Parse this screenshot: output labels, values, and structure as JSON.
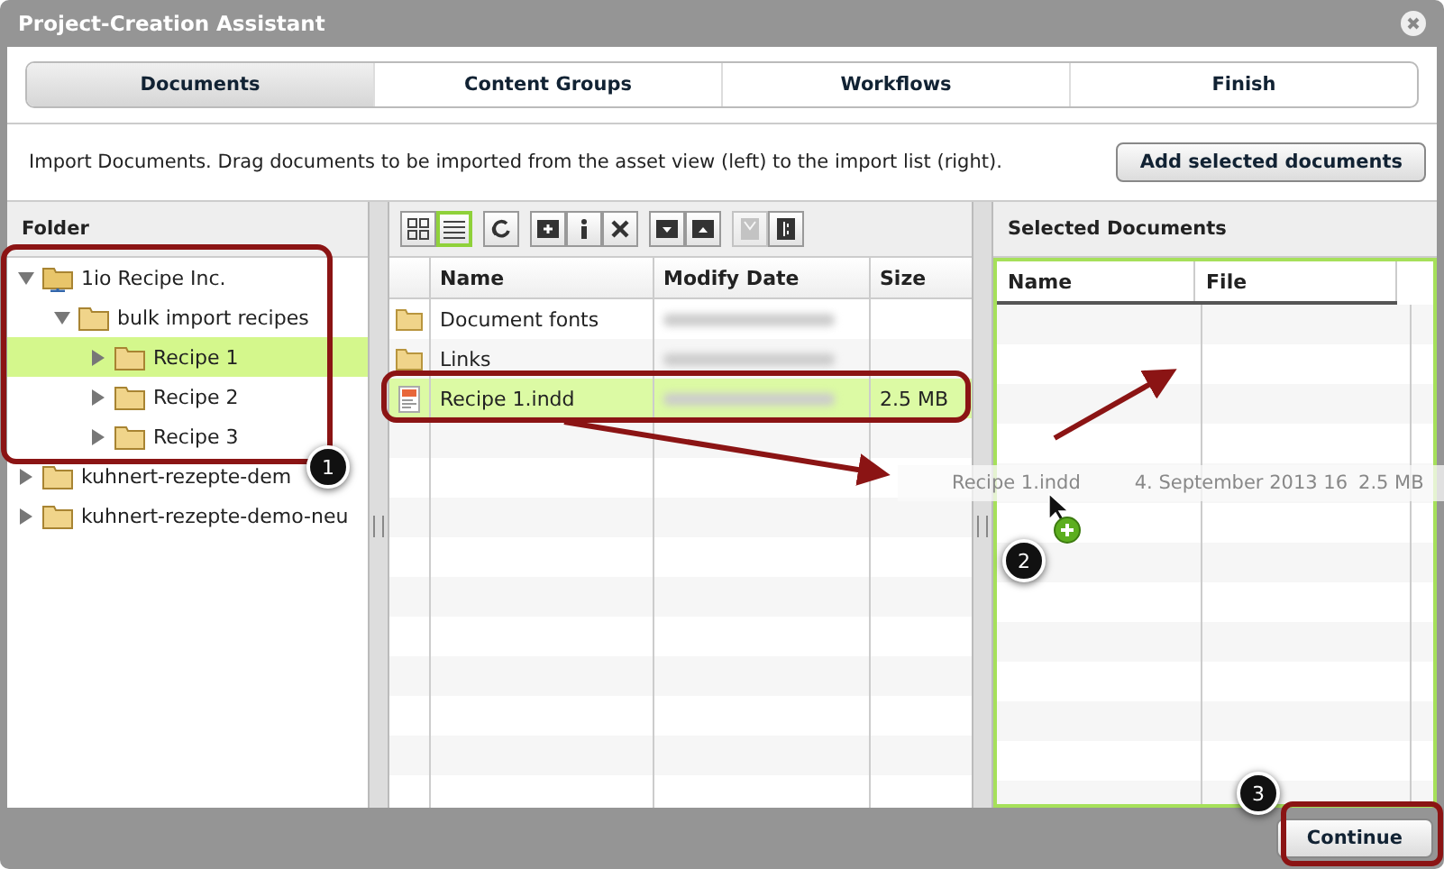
{
  "window": {
    "title": "Project-Creation Assistant"
  },
  "steps": [
    {
      "label": "Documents",
      "selected": true
    },
    {
      "label": "Content Groups",
      "selected": false
    },
    {
      "label": "Workflows",
      "selected": false
    },
    {
      "label": "Finish",
      "selected": false
    }
  ],
  "instruction": "Import Documents. Drag documents to be imported from the asset view (left) to the import list (right).",
  "add_button": "Add selected documents",
  "folder_panel": {
    "title": "Folder",
    "tree": [
      {
        "label": "1io Recipe Inc.",
        "kind": "server",
        "expanded": true,
        "selected": false,
        "children": [
          {
            "label": "bulk import recipes",
            "kind": "folder",
            "expanded": true,
            "selected": false,
            "children": [
              {
                "label": "Recipe 1",
                "kind": "folder",
                "expanded": false,
                "selected": true
              },
              {
                "label": "Recipe 2",
                "kind": "folder",
                "expanded": false,
                "selected": false
              },
              {
                "label": "Recipe 3",
                "kind": "folder",
                "expanded": false,
                "selected": false
              }
            ]
          }
        ]
      },
      {
        "label": "kuhnert-rezepte-dem",
        "kind": "folder",
        "expanded": false,
        "selected": false
      },
      {
        "label": "kuhnert-rezepte-demo-neu",
        "kind": "folder",
        "expanded": false,
        "selected": false
      }
    ]
  },
  "view_toggle": [
    {
      "kind": "grid",
      "selected": false
    },
    {
      "kind": "list",
      "selected": true
    }
  ],
  "tools": [
    {
      "kind": "refresh",
      "disabled": false
    },
    {
      "kind": "new-folder",
      "disabled": false
    },
    {
      "kind": "info",
      "disabled": false
    },
    {
      "kind": "delete",
      "disabled": false
    },
    {
      "kind": "folder-down",
      "disabled": false
    },
    {
      "kind": "folder-up",
      "disabled": false
    },
    {
      "kind": "column-left",
      "disabled": true
    },
    {
      "kind": "column-right",
      "disabled": false
    }
  ],
  "asset_table": {
    "columns": [
      "Name",
      "Modify Date",
      "Size"
    ],
    "rows": [
      {
        "kind": "folder",
        "name": "Document fonts",
        "selected": false
      },
      {
        "kind": "folder",
        "name": "Links",
        "selected": false
      },
      {
        "kind": "file",
        "name": "Recipe 1.indd",
        "size": "2.5 MB",
        "selected": true
      }
    ]
  },
  "selected_panel": {
    "title": "Selected Documents",
    "columns": [
      "Name",
      "File"
    ]
  },
  "drag_ghost": {
    "name": "Recipe 1.indd",
    "date": "4. September 2013 16",
    "size": "2.5 MB"
  },
  "callouts": [
    "1",
    "2",
    "3"
  ],
  "continue_button": "Continue"
}
